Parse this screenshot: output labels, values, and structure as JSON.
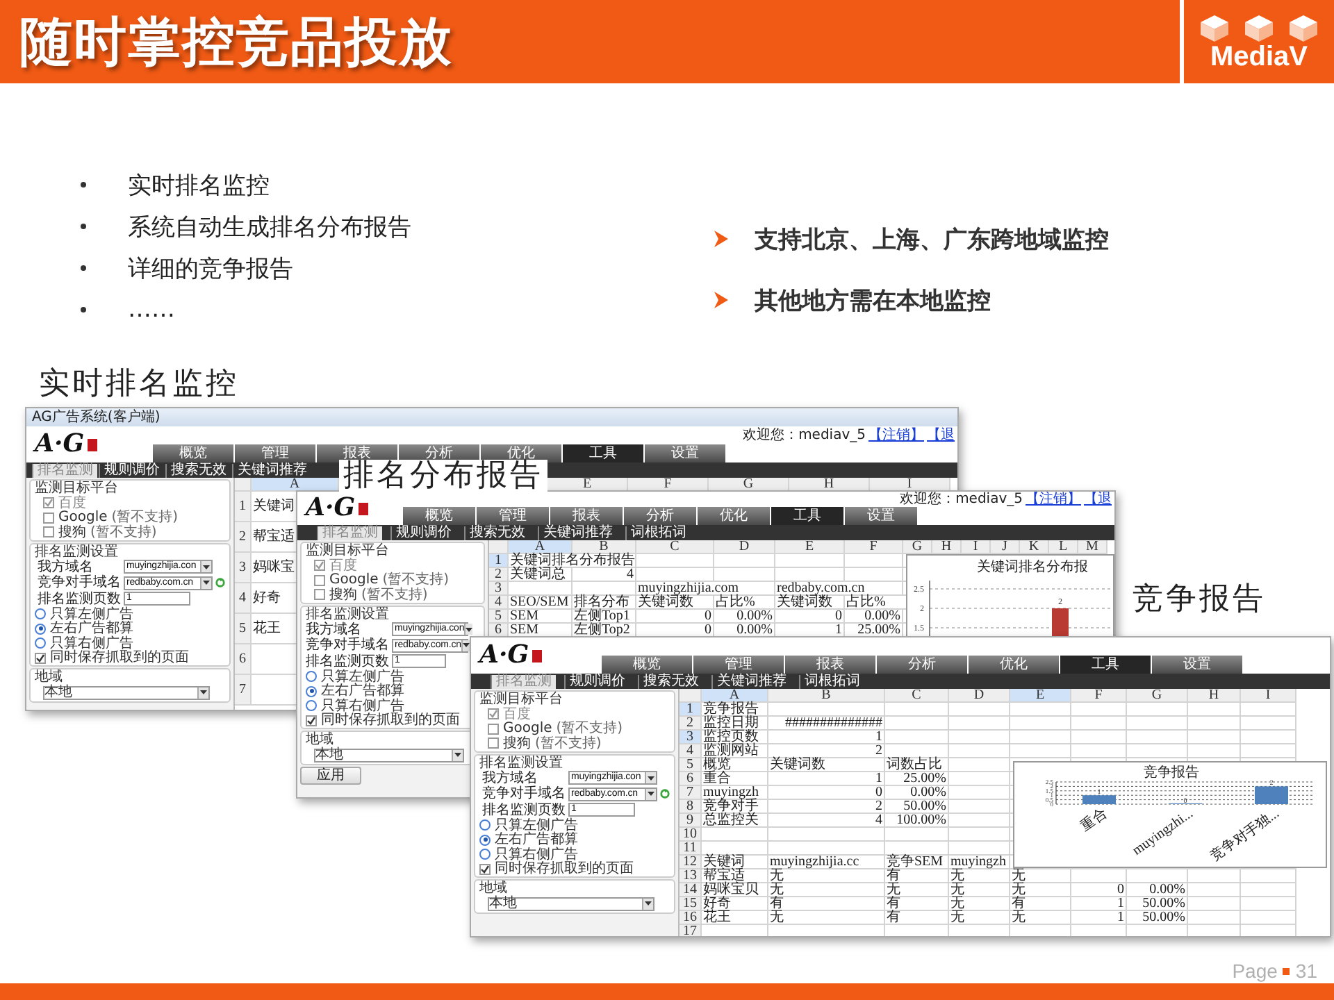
{
  "header": {
    "title": "随时掌控竞品投放",
    "logo_text": "MediaV"
  },
  "bullets": [
    "实时排名监控",
    "系统自动生成排名分布报告",
    "详细的竞争报告",
    "……"
  ],
  "highlights": [
    "支持北京、上海、广东跨地域监控",
    "其他地方需在本地监控"
  ],
  "screenshots": [
    {
      "label": "实时排名监控",
      "window_title": "AG广告系统(客户端)",
      "logo": "A·G",
      "welcome": "欢迎您：mediav_5",
      "links": [
        "【注销】",
        "【退"
      ],
      "nav": [
        {
          "label": "概览",
          "selected": false
        },
        {
          "label": "管理",
          "selected": false
        },
        {
          "label": "报表",
          "selected": false
        },
        {
          "label": "分析",
          "selected": false
        },
        {
          "label": "优化",
          "selected": false
        },
        {
          "label": "工具",
          "selected": true
        },
        {
          "label": "设置",
          "selected": false
        }
      ],
      "subnav": [
        {
          "label": "排名监测",
          "selected": true
        },
        {
          "label": "规则调价",
          "selected": false
        },
        {
          "label": "搜索无效",
          "selected": false
        },
        {
          "label": "关键词推荐",
          "selected": false
        }
      ],
      "panel": {
        "platform_title": "监测目标平台",
        "platforms": [
          {
            "name": "百度",
            "checked": true
          },
          {
            "name": "Google",
            "note": "(暂不支持)",
            "checked": false
          },
          {
            "name": "搜狗",
            "note": "(暂不支持)",
            "checked": false
          }
        ],
        "settings_title": "排名监测设置",
        "fields": [
          {
            "label": "我方域名",
            "value": "muyingzhijia.con",
            "kind": "select",
            "has_icon": false
          },
          {
            "label": "竞争对手域名",
            "value": "redbaby.com.cn",
            "kind": "select",
            "has_icon": true
          },
          {
            "label": "排名监测页数",
            "value": "1",
            "kind": "text",
            "has_icon": false
          }
        ],
        "radios": [
          {
            "label": "只算左侧广告",
            "selected": false
          },
          {
            "label": "左右广告都算",
            "selected": true
          },
          {
            "label": "只算右侧广告",
            "selected": false
          }
        ],
        "save_pages": {
          "label": "同时保存抓取到的页面",
          "checked": true
        },
        "region_title": "地域",
        "region_value": "本地"
      },
      "grid": {
        "columns": [
          {
            "label": "A",
            "selected": true
          },
          {
            "label": "E",
            "selected": false
          },
          {
            "label": "F",
            "selected": false
          },
          {
            "label": "G",
            "selected": false
          },
          {
            "label": "H",
            "selected": false
          },
          {
            "label": "I",
            "selected": false
          }
        ],
        "rows": [
          {
            "number": "1",
            "selected": false,
            "cells": [
              "关键词"
            ]
          },
          {
            "number": "2",
            "selected": false,
            "cells": [
              "帮宝适"
            ]
          },
          {
            "number": "3",
            "selected": false,
            "cells": [
              "妈咪宝"
            ]
          },
          {
            "number": "4",
            "selected": false,
            "cells": [
              "好奇"
            ]
          },
          {
            "number": "5",
            "selected": false,
            "cells": [
              "花王"
            ]
          },
          {
            "number": "6",
            "selected": false,
            "cells": []
          },
          {
            "number": "7",
            "selected": false,
            "cells": []
          }
        ]
      }
    },
    {
      "label": "排名分布报告",
      "logo": "A·G",
      "welcome": "欢迎您：mediav_5",
      "links": [
        "【注销】",
        "【退"
      ],
      "nav": [
        {
          "label": "概览",
          "selected": false
        },
        {
          "label": "管理",
          "selected": false
        },
        {
          "label": "报表",
          "selected": false
        },
        {
          "label": "分析",
          "selected": false
        },
        {
          "label": "优化",
          "selected": false
        },
        {
          "label": "工具",
          "selected": true
        },
        {
          "label": "设置",
          "selected": false
        }
      ],
      "subnav": [
        {
          "label": "排名监测",
          "selected": true
        },
        {
          "label": "规则调价",
          "selected": false
        },
        {
          "label": "搜索无效",
          "selected": false
        },
        {
          "label": "关键词推荐",
          "selected": false
        },
        {
          "label": "词根拓词",
          "selected": false
        }
      ],
      "panel": {
        "platform_title": "监测目标平台",
        "platforms": [
          {
            "name": "百度",
            "checked": true
          },
          {
            "name": "Google",
            "note": "(暂不支持)",
            "checked": false
          },
          {
            "name": "搜狗",
            "note": "(暂不支持)",
            "checked": false
          }
        ],
        "settings_title": "排名监测设置",
        "fields": [
          {
            "label": "我方域名",
            "value": "muyingzhijia.con",
            "kind": "select"
          },
          {
            "label": "竞争对手域名",
            "value": "redbaby.com.cn",
            "kind": "select"
          },
          {
            "label": "排名监测页数",
            "value": "1",
            "kind": "text"
          }
        ],
        "radios": [
          {
            "label": "只算左侧广告",
            "selected": false
          },
          {
            "label": "左右广告都算",
            "selected": true
          },
          {
            "label": "只算右侧广告",
            "selected": false
          }
        ],
        "save_pages": {
          "label": "同时保存抓取到的页面",
          "checked": true
        },
        "region_title": "地域",
        "region_value": "本地",
        "apply_button": "应用"
      },
      "grid": {
        "columns": [
          {
            "label": "A",
            "selected": true
          },
          {
            "label": "B",
            "selected": false
          },
          {
            "label": "C",
            "selected": false
          },
          {
            "label": "D",
            "selected": false
          },
          {
            "label": "E",
            "selected": false
          },
          {
            "label": "F",
            "selected": false
          },
          {
            "label": "G",
            "selected": false
          },
          {
            "label": "H",
            "selected": false
          },
          {
            "label": "I",
            "selected": false
          },
          {
            "label": "J",
            "selected": false
          },
          {
            "label": "K",
            "selected": false
          },
          {
            "label": "L",
            "selected": false
          },
          {
            "label": "M",
            "selected": false
          }
        ],
        "rows": [
          {
            "number": "1",
            "selected": true,
            "cells": [
              "关键词排名分布报告"
            ]
          },
          {
            "number": "2",
            "selected": false,
            "cells": [
              "关键词总",
              "4"
            ]
          },
          {
            "number": "3",
            "selected": false,
            "cells": [
              null,
              null,
              "muyingzhijia.com",
              null,
              "redbaby.com.cn"
            ]
          },
          {
            "number": "4",
            "selected": false,
            "cells": [
              "SEO/SEM",
              "排名分布",
              "关键词数",
              "占比%",
              "关键词数",
              "占比%"
            ]
          },
          {
            "number": "5",
            "selected": false,
            "cells": [
              "SEM",
              "左侧Top1",
              "0",
              "0.00%",
              "0",
              "0.00%"
            ]
          },
          {
            "number": "6",
            "selected": false,
            "cells": [
              "SEM",
              "左侧Top2",
              "0",
              "0.00%",
              "1",
              "25.00%"
            ]
          }
        ]
      },
      "chart_picture": {
        "title": "关键词排名分布报",
        "tick_labels": [
          "2.5",
          "2",
          "1.5"
        ],
        "bar_label": "2"
      }
    },
    {
      "label": "竞争报告",
      "logo": "A·G",
      "nav": [
        {
          "label": "概览",
          "selected": false
        },
        {
          "label": "管理",
          "selected": false
        },
        {
          "label": "报表",
          "selected": false
        },
        {
          "label": "分析",
          "selected": false
        },
        {
          "label": "优化",
          "selected": false
        },
        {
          "label": "工具",
          "selected": true
        },
        {
          "label": "设置",
          "selected": false
        }
      ],
      "subnav": [
        {
          "label": "排名监测",
          "selected": true
        },
        {
          "label": "规则调价",
          "selected": false
        },
        {
          "label": "搜索无效",
          "selected": false
        },
        {
          "label": "关键词推荐",
          "selected": false
        },
        {
          "label": "词根拓词",
          "selected": false
        }
      ],
      "panel": {
        "platform_title": "监测目标平台",
        "platforms": [
          {
            "name": "百度",
            "checked": true
          },
          {
            "name": "Google",
            "note": "(暂不支持)",
            "checked": false
          },
          {
            "name": "搜狗",
            "note": "(暂不支持)",
            "checked": false
          }
        ],
        "settings_title": "排名监测设置",
        "fields": [
          {
            "label": "我方域名",
            "value": "muyingzhijia.con",
            "kind": "select",
            "has_icon": false
          },
          {
            "label": "竞争对手域名",
            "value": "redbaby.com.cn",
            "kind": "select",
            "has_icon": true
          },
          {
            "label": "排名监测页数",
            "value": "1",
            "kind": "text",
            "has_icon": false
          }
        ],
        "radios": [
          {
            "label": "只算左侧广告",
            "selected": false
          },
          {
            "label": "左右广告都算",
            "selected": true
          },
          {
            "label": "只算右侧广告",
            "selected": false
          }
        ],
        "save_pages": {
          "label": "同时保存抓取到的页面",
          "checked": true
        },
        "region_title": "地域",
        "region_value": "本地"
      },
      "grid": {
        "columns": [
          {
            "label": "A",
            "selected": true
          },
          {
            "label": "B",
            "selected": false
          },
          {
            "label": "C",
            "selected": false
          },
          {
            "label": "D",
            "selected": false
          },
          {
            "label": "E",
            "selected": true
          },
          {
            "label": "F",
            "selected": false
          },
          {
            "label": "G",
            "selected": false
          },
          {
            "label": "H",
            "selected": false
          },
          {
            "label": "I",
            "selected": false
          }
        ],
        "rows": [
          {
            "number": "1",
            "selected": true,
            "cells": [
              "竞争报告"
            ]
          },
          {
            "number": "2",
            "selected": false,
            "cells": [
              "监控日期",
              "##############"
            ]
          },
          {
            "number": "3",
            "selected": true,
            "cells": [
              "监控页数",
              "1"
            ]
          },
          {
            "number": "4",
            "selected": false,
            "cells": [
              "监测网站",
              "2"
            ]
          },
          {
            "number": "5",
            "selected": false,
            "cells": [
              "概览",
              "关键词数",
              "词数占比"
            ]
          },
          {
            "number": "6",
            "selected": false,
            "cells": [
              "重合",
              "1",
              "25.00%"
            ]
          },
          {
            "number": "7",
            "selected": false,
            "cells": [
              "muyingzh",
              "0",
              "0.00%"
            ]
          },
          {
            "number": "8",
            "selected": false,
            "cells": [
              "竞争对手",
              "2",
              "50.00%"
            ]
          },
          {
            "number": "9",
            "selected": false,
            "cells": [
              "总监控关",
              "4",
              "100.00%"
            ]
          },
          {
            "number": "10",
            "selected": false,
            "cells": []
          },
          {
            "number": "11",
            "selected": false,
            "cells": []
          },
          {
            "number": "12",
            "selected": false,
            "cells": [
              "关键词",
              "muyingzhijia.cc",
              "竞争SEM",
              "muyingzh"
            ]
          },
          {
            "number": "13",
            "selected": false,
            "cells": [
              "帮宝适",
              "无",
              "有",
              "无",
              "无"
            ]
          },
          {
            "number": "14",
            "selected": false,
            "cells": [
              "妈咪宝贝",
              "无",
              "无",
              "无",
              "无",
              "0",
              "0.00%"
            ]
          },
          {
            "number": "15",
            "selected": false,
            "cells": [
              "好奇",
              "有",
              "有",
              "无",
              "有",
              "1",
              "50.00%"
            ]
          },
          {
            "number": "16",
            "selected": false,
            "cells": [
              "花王",
              "无",
              "有",
              "无",
              "无",
              "1",
              "50.00%"
            ]
          },
          {
            "number": "17",
            "selected": false,
            "cells": []
          }
        ]
      },
      "chart_data": {
        "type": "bar",
        "title": "竞争报告",
        "categories": [
          "重合",
          "muyingzhi...",
          "竞争对手独..."
        ],
        "values": [
          1,
          0,
          2
        ],
        "ylim": [
          0,
          2.5
        ],
        "yticks": [
          0,
          0.5,
          1,
          1.5,
          2,
          2.5
        ],
        "grid": true,
        "data_labels": true
      }
    }
  ],
  "footer": {
    "page_label": "Page",
    "page_number": "31"
  }
}
